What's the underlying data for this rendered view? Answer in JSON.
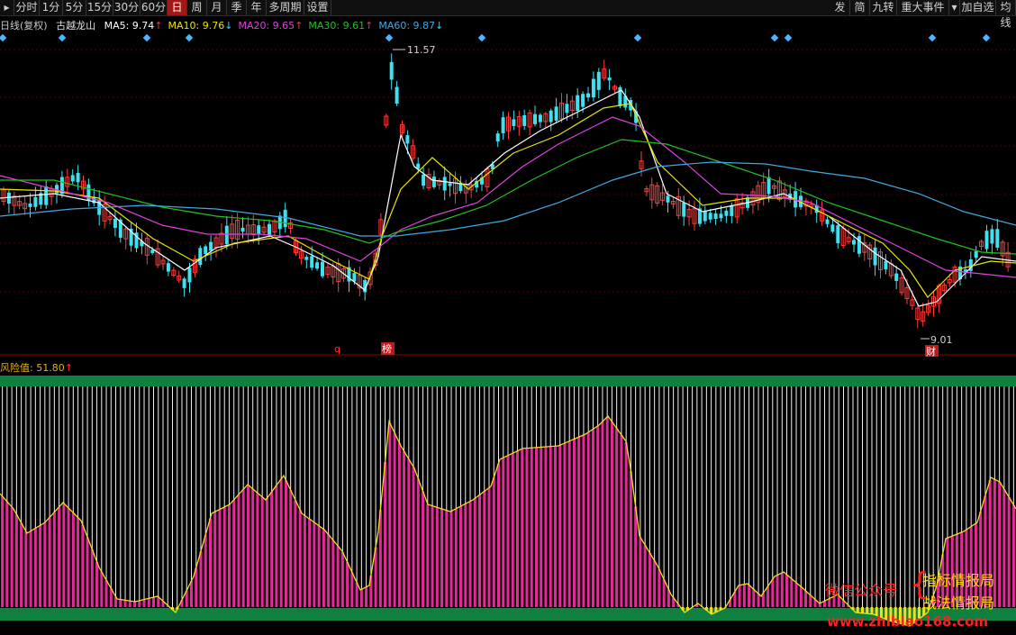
{
  "toolbar": {
    "left_tabs": [
      "分时",
      "1分",
      "5分",
      "15分",
      "30分",
      "60分",
      "日",
      "周",
      "月",
      "季",
      "年",
      "多周期",
      "设置"
    ],
    "active_tab": "日",
    "right_tabs": [
      "发",
      "简",
      "九转",
      "重大事件",
      "加自选",
      "均线"
    ]
  },
  "kline": {
    "period_label": "日线(复权)",
    "stock_name": "古越龙山",
    "ma": [
      {
        "label": "MA5: 9.74",
        "arrow": "↑",
        "color": "#ffffff"
      },
      {
        "label": "MA10: 9.76",
        "arrow": "↓",
        "color": "#e6e600"
      },
      {
        "label": "MA20: 9.65",
        "arrow": "↑",
        "color": "#e040e0"
      },
      {
        "label": "MA30: 9.61",
        "arrow": "↑",
        "color": "#20c020"
      },
      {
        "label": "MA60: 9.87",
        "arrow": "↓",
        "color": "#40a8e0"
      }
    ],
    "high_label": "11.57",
    "low_label": "9.01",
    "markers": [
      "q",
      "榜",
      "财"
    ]
  },
  "indicator": {
    "name": "风险值",
    "value": "51.80",
    "arrow": "↑"
  },
  "watermark": {
    "line1": "微信公众号",
    "line2": "指标情报局",
    "line3": "战法情报局",
    "url": "www.zhibiao168.com"
  }
}
